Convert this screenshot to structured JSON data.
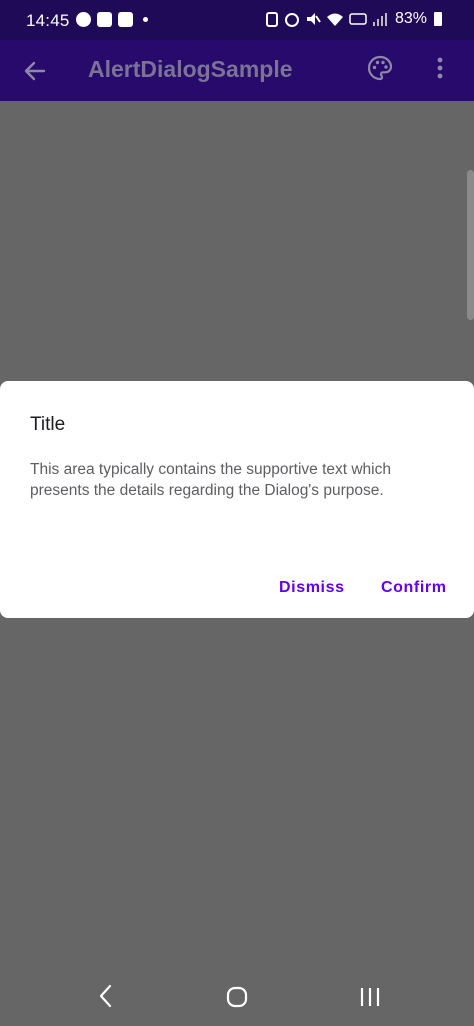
{
  "status_bar": {
    "time": "14:45",
    "battery": "83%",
    "left_icons": [
      "messenger-icon",
      "notification-icon",
      "linkedin-icon",
      "dot-icon"
    ],
    "right_icons": [
      "battery-saver-icon",
      "alarm-icon",
      "mute-icon",
      "wifi-icon",
      "volte-icon",
      "signal-icon",
      "battery-icon"
    ]
  },
  "app_bar": {
    "title": "AlertDialogSample",
    "back_icon": "arrow-back-icon",
    "palette_icon": "palette-icon",
    "more_icon": "more-vert-icon"
  },
  "dialog": {
    "title": "Title",
    "text": "This area typically contains the supportive text which presents the details regarding the Dialog's purpose.",
    "dismiss_label": "Dismiss",
    "confirm_label": "Confirm"
  },
  "nav_bar": {
    "back_icon": "nav-back-icon",
    "home_icon": "nav-home-icon",
    "recents_icon": "nav-recents-icon"
  },
  "colors": {
    "status_bar": "#1e0a57",
    "app_bar": "#270a6b",
    "scrim": "#666666",
    "accent": "#6200ee"
  }
}
